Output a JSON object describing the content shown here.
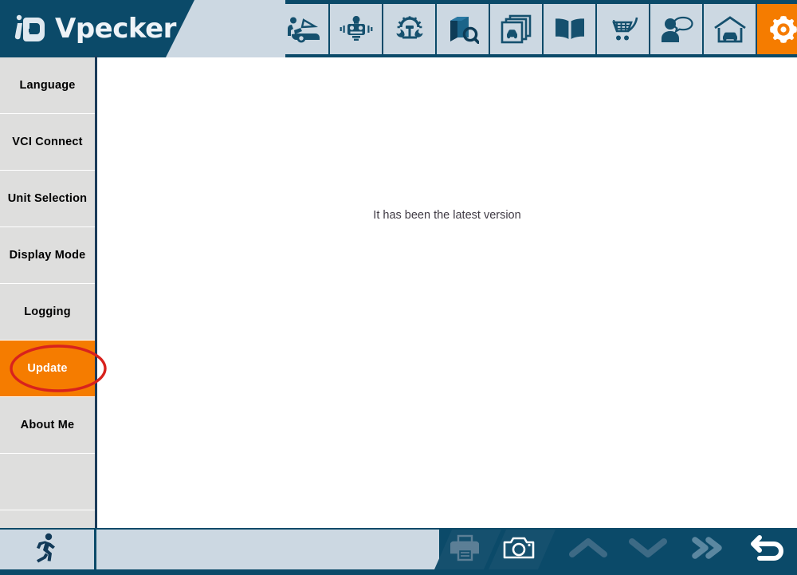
{
  "app": {
    "brand": "Vpecker",
    "logo_icon": "id-monogram-logo"
  },
  "header": {
    "tools": [
      {
        "name": "diagnosis-icon",
        "label": "Diagnosis"
      },
      {
        "name": "actuation-test-icon",
        "label": "Actuation Test"
      },
      {
        "name": "special-function-icon",
        "label": "Special Function"
      },
      {
        "name": "manual-search-icon",
        "label": "Manual Search"
      },
      {
        "name": "vehicle-library-icon",
        "label": "Vehicle Library"
      },
      {
        "name": "help-book-icon",
        "label": "Help"
      },
      {
        "name": "shopping-cart-icon",
        "label": "Shop"
      },
      {
        "name": "feedback-icon",
        "label": "Feedback"
      },
      {
        "name": "garage-icon",
        "label": "Garage"
      },
      {
        "name": "settings-gear-icon",
        "label": "Settings"
      }
    ],
    "active_tool_index": 9
  },
  "sidebar": {
    "items": [
      {
        "label": "Language",
        "active": false
      },
      {
        "label": "VCI Connect",
        "active": false
      },
      {
        "label": "Unit Selection",
        "active": false
      },
      {
        "label": "Display Mode",
        "active": false
      },
      {
        "label": "Logging",
        "active": false
      },
      {
        "label": "Update",
        "active": true
      },
      {
        "label": "About Me",
        "active": false
      },
      {
        "label": "",
        "active": false
      }
    ],
    "scroll_down_icon": "chevron-down-icon"
  },
  "main": {
    "message": "It has been the latest version"
  },
  "annotation": {
    "shape": "red-ellipse-highlight",
    "target": "Update",
    "color": "#d8221d"
  },
  "bottom_bar": {
    "run_icon": "running-man-icon",
    "status_text": "",
    "print_icon": "printer-icon",
    "screenshot_icon": "camera-icon",
    "nav": [
      {
        "name": "scroll-up-icon",
        "label": "Up",
        "enabled": false
      },
      {
        "name": "scroll-down-icon",
        "label": "Down",
        "enabled": false
      },
      {
        "name": "next-page-icon",
        "label": "Next",
        "enabled": true
      },
      {
        "name": "back-icon",
        "label": "Back",
        "enabled": true
      }
    ]
  },
  "colors": {
    "brand_navy": "#0b4a69",
    "accent_orange": "#f57c00",
    "panel_gray": "#dededd",
    "light_blue": "#ccd8e2",
    "annotation_red": "#d8221d"
  }
}
